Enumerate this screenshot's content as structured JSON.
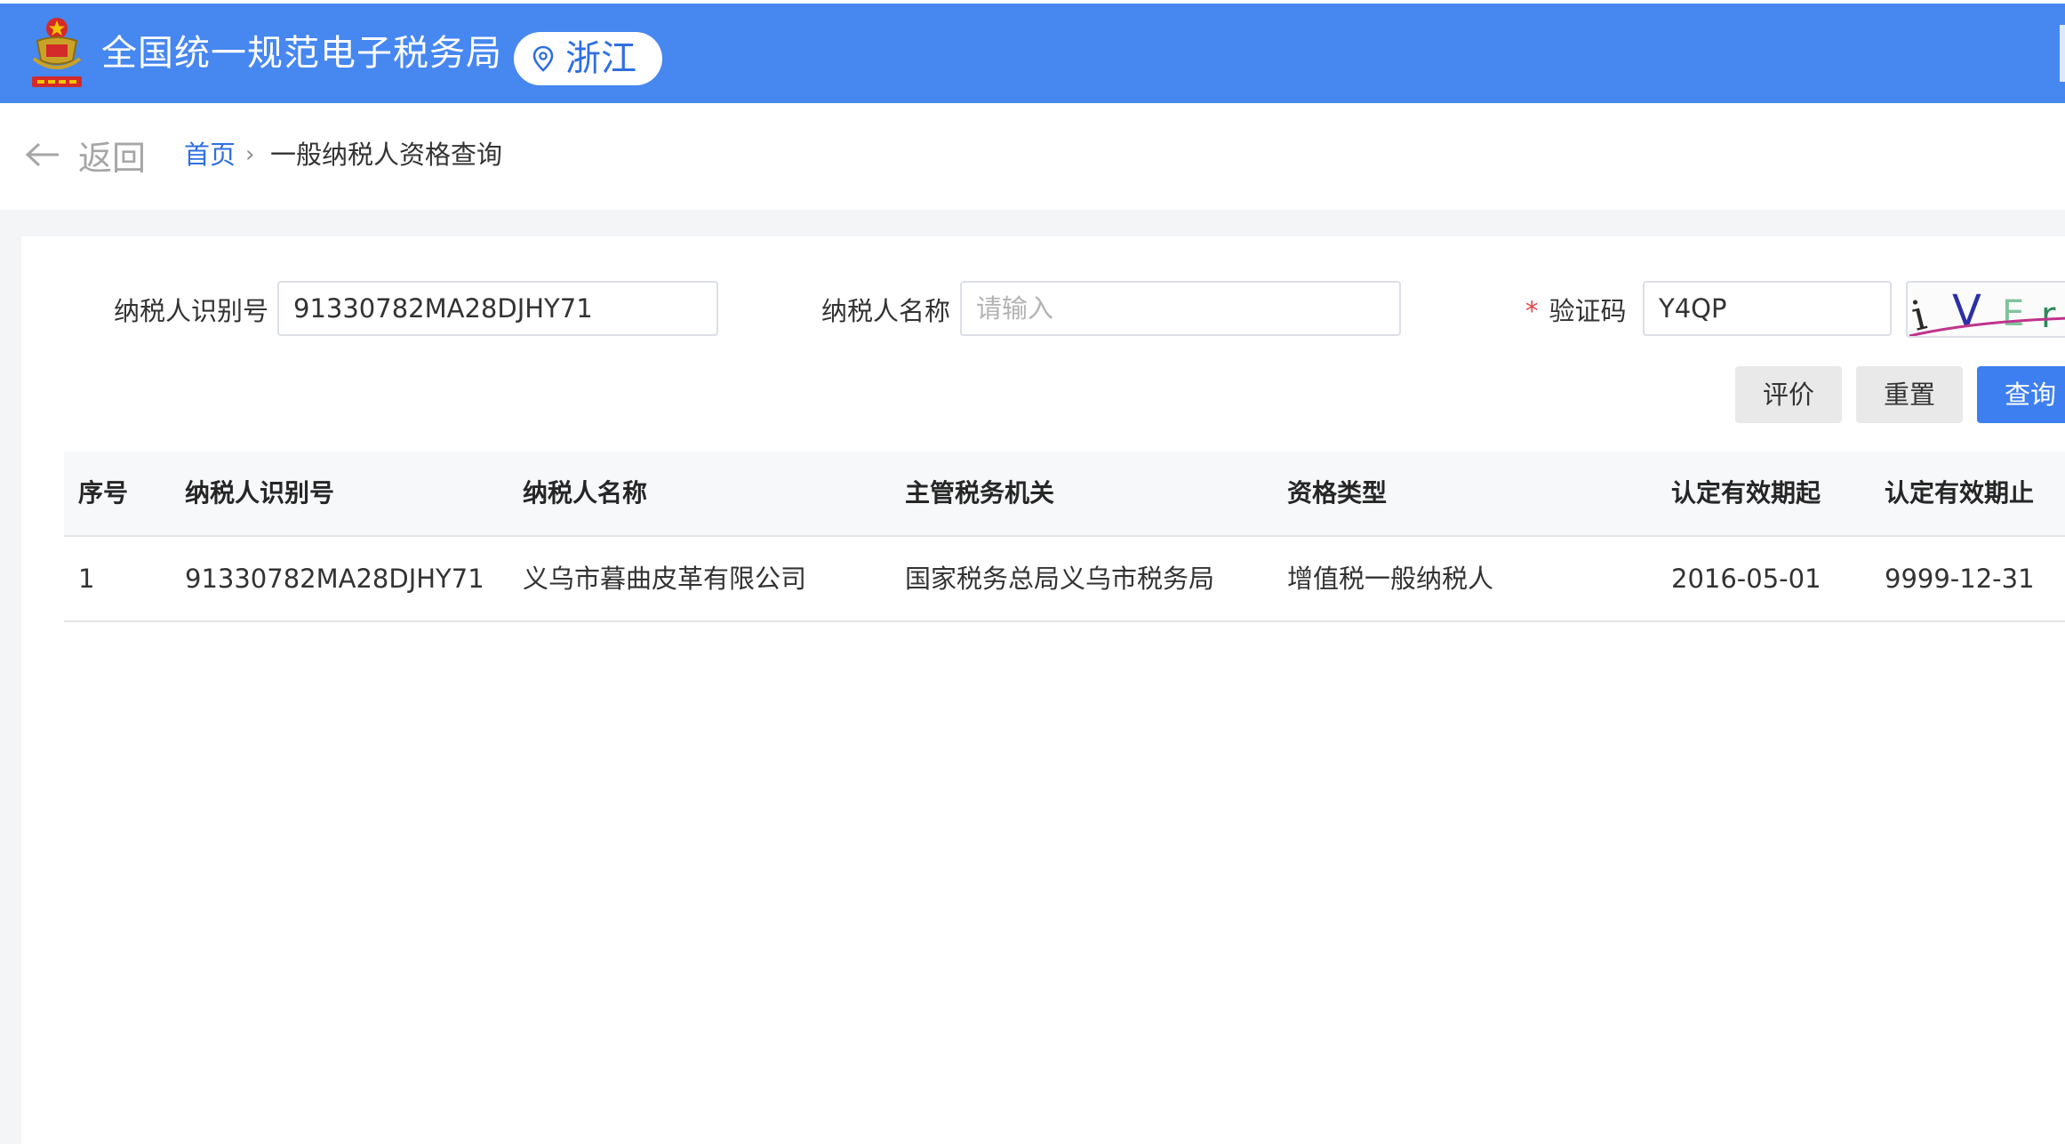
{
  "header": {
    "site_title": "全国统一规范电子税务局",
    "region": "浙江"
  },
  "nav": {
    "back_label": "返回",
    "breadcrumb_home": "首页",
    "breadcrumb_separator": "›",
    "breadcrumb_current": "一般纳税人资格查询"
  },
  "form": {
    "taxpayer_id_label": "纳税人识别号",
    "taxpayer_id_value": "91330782MA28DJHY71",
    "taxpayer_name_label": "纳税人名称",
    "taxpayer_name_placeholder": "请输入",
    "captcha_required_mark": "*",
    "captcha_label": "验证码",
    "captcha_value": "Y4QP",
    "captcha_image_text": "iVEr"
  },
  "buttons": {
    "evaluate": "评价",
    "reset": "重置",
    "query": "查询"
  },
  "table": {
    "columns": [
      "序号",
      "纳税人识别号",
      "纳税人名称",
      "主管税务机关",
      "资格类型",
      "认定有效期起",
      "认定有效期止"
    ],
    "rows": [
      [
        "1",
        "91330782MA28DJHY71",
        "义乌市暮曲皮革有限公司",
        "国家税务总局义乌市税务局",
        "增值税一般纳税人",
        "2016-05-01",
        "9999-12-31"
      ]
    ]
  },
  "colors": {
    "header_blue": "#4687f0",
    "link_blue": "#2f6fe0",
    "primary_button": "#3d7ff0",
    "required_red": "#e0484a"
  }
}
